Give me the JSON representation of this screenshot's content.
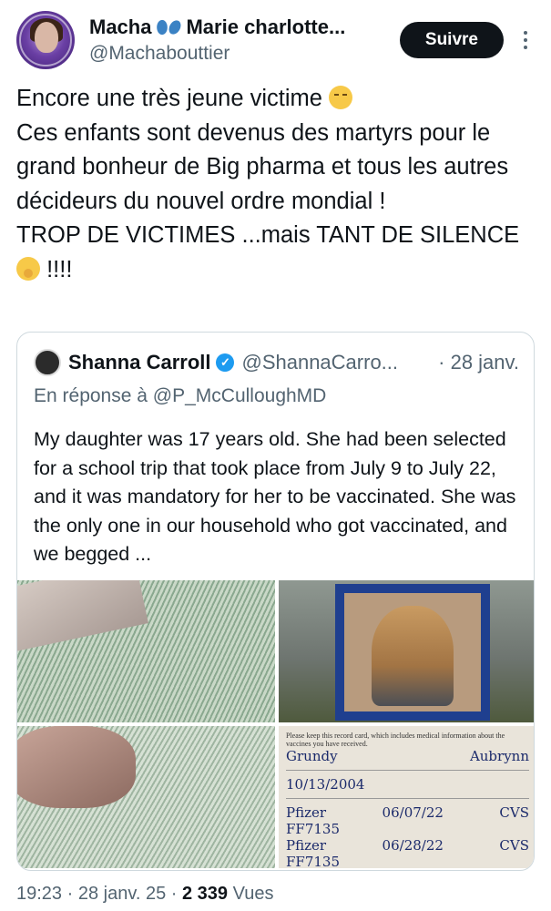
{
  "author": {
    "display_name": "Macha",
    "display_name_rest": "Marie charlotte...",
    "handle": "@Machabouttier",
    "follow_label": "Suivre"
  },
  "tweet": {
    "line1": "Encore une très jeune victime",
    "line2": "Ces enfants sont devenus des martyrs pour le grand bonheur de Big pharma et tous les autres décideurs du nouvel ordre mondial !",
    "line3": "TROP DE VICTIMES ...mais TANT DE SILENCE",
    "line3_end": "!!!!"
  },
  "quoted": {
    "name": "Shanna Carroll",
    "handle": "@ShannaCarro...",
    "date": "· 28 janv.",
    "reply_prefix": "En réponse à",
    "reply_mention": "@P_McCulloughMD",
    "text": "My daughter was 17 years old. She had been selected for a school trip that took place from July 9 to July 22, and it was mandatory for her to be vaccinated. She was the only one in our household who got vaccinated, and we begged ...",
    "card": {
      "header": "Please keep this record card, which includes medical information about the vaccines you have received.",
      "last_name": "Grundy",
      "first_name": "Aubrynn",
      "dob": "10/13/2004",
      "dose1_product": "Pfizer",
      "dose1_lot": "FF7135",
      "dose1_date": "06/07/22",
      "dose1_site": "CVS",
      "dose2_product": "Pfizer",
      "dose2_lot": "FF7135",
      "dose2_date": "06/28/22",
      "dose2_site": "CVS"
    }
  },
  "meta": {
    "time": "19:23",
    "date": "28 janv. 25",
    "views_count": "2 339",
    "views_label": "Vues"
  }
}
